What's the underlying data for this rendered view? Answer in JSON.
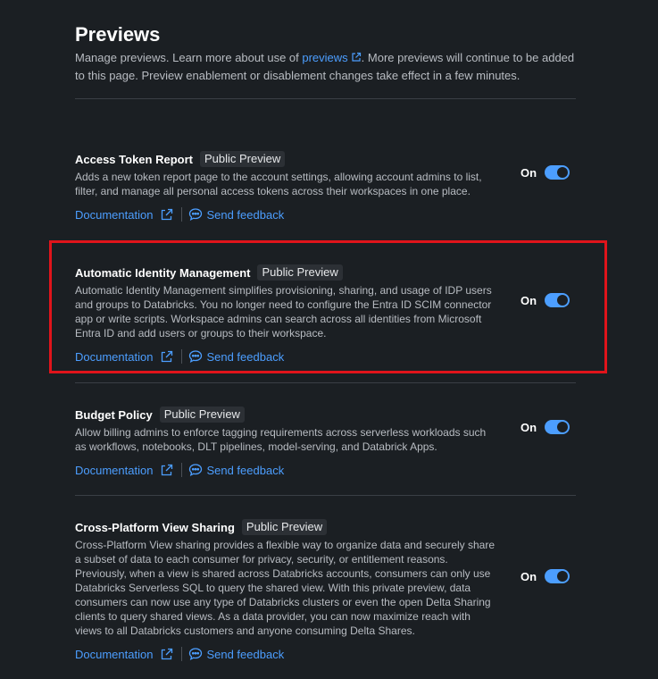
{
  "page": {
    "title": "Previews",
    "intro_before": "Manage previews. Learn more about use of ",
    "intro_link": "previews",
    "intro_after": ". More previews will continue to be added to this page. Preview enablement or disablement changes take effect in a few minutes."
  },
  "colors": {
    "accent": "#4c9eff",
    "highlight": "#e0141b",
    "background": "#1b1f23"
  },
  "features": [
    {
      "title": "Access Token Report",
      "badge": "Public Preview",
      "description": "Adds a new token report page to the account settings, allowing account admins to list, filter, and manage all personal access tokens across their workspaces in one place.",
      "doc_label": "Documentation",
      "feedback_label": "Send feedback",
      "toggle_label": "On",
      "enabled": true
    },
    {
      "title": "Automatic Identity Management",
      "badge": "Public Preview",
      "description": "Automatic Identity Management simplifies provisioning, sharing, and usage of IDP users and groups to Databricks. You no longer need to configure the Entra ID SCIM connector app or write scripts. Workspace admins can search across all identities from Microsoft Entra ID and add users or groups to their workspace.",
      "doc_label": "Documentation",
      "feedback_label": "Send feedback",
      "toggle_label": "On",
      "enabled": true
    },
    {
      "title": "Budget Policy",
      "badge": "Public Preview",
      "description": "Allow billing admins to enforce tagging requirements across serverless workloads such as workflows, notebooks, DLT pipelines, model-serving, and Databrick Apps.",
      "doc_label": "Documentation",
      "feedback_label": "Send feedback",
      "toggle_label": "On",
      "enabled": true
    },
    {
      "title": "Cross-Platform View Sharing",
      "badge": "Public Preview",
      "description": "Cross-Platform View sharing provides a flexible way to organize data and securely share a subset of data to each consumer for privacy, security, or entitlement reasons. Previously, when a view is shared across Databricks accounts, consumers can only use Databricks Serverless SQL to query the shared view. With this private preview, data consumers can now use any type of Databricks clusters or even the open Delta Sharing clients to query shared views. As a data provider, you can now maximize reach with views to all Databricks customers and anyone consuming Delta Shares.",
      "doc_label": "Documentation",
      "feedback_label": "Send feedback",
      "toggle_label": "On",
      "enabled": true
    }
  ]
}
